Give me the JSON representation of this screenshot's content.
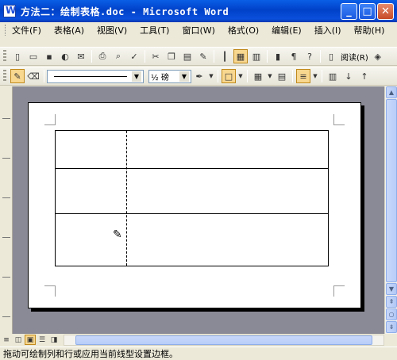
{
  "window": {
    "title": "方法二：绘制表格.doc - Microsoft Word"
  },
  "menu": {
    "items": [
      "文件(F)",
      "表格(A)",
      "视图(V)",
      "工具(T)",
      "窗口(W)",
      "格式(O)",
      "编辑(E)",
      "插入(I)",
      "帮助(H)"
    ]
  },
  "toolbar_std": {
    "read_label": "阅读(R)"
  },
  "toolbar_tables": {
    "line_weight": "½ 磅"
  },
  "status": {
    "text": "拖动可绘制列和行或应用当前线型设置边框。"
  }
}
